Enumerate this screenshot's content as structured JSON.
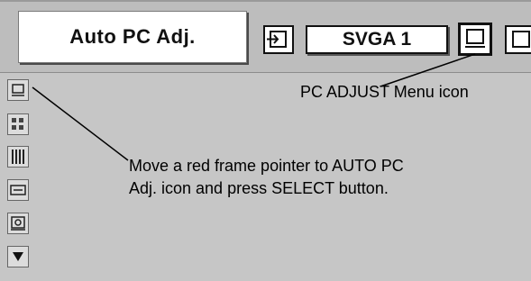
{
  "menu": {
    "title": "Auto PC Adj.",
    "mode": "SVGA 1"
  },
  "icons": {
    "input": "input-source-icon",
    "pc_adjust": "pc-adjust-menu-icon",
    "next": "next-menu-icon",
    "side": [
      "auto-pc-adj-icon",
      "fine-sync-icon",
      "total-dots-icon",
      "position-icon",
      "store-icon",
      "scroll-down-icon"
    ]
  },
  "callouts": {
    "pc_adjust_icon": "PC ADJUST Menu icon",
    "instruction_line1": "Move a red frame pointer to AUTO PC",
    "instruction_line2": "Adj. icon and press SELECT button."
  },
  "colors": {
    "panel": "#c6c6c6",
    "bar": "#bdbdbd",
    "text": "#000000"
  }
}
